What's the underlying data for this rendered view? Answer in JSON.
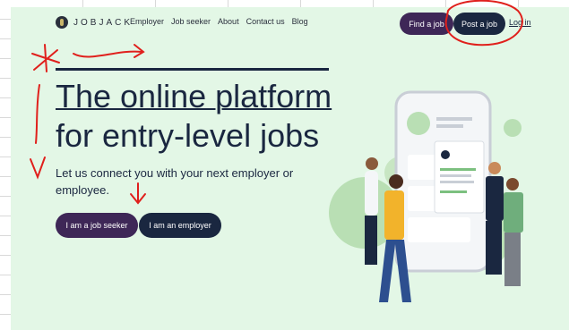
{
  "header": {
    "logo_text": "JOBJACK",
    "nav": [
      "Employer",
      "Job seeker",
      "About",
      "Contact us",
      "Blog"
    ],
    "find_job": "Find a job",
    "post_job": "Post a job",
    "login": "Log in"
  },
  "hero": {
    "title_line1": "The online platform",
    "title_line2": "for entry-level jobs",
    "subtitle": "Let us connect you with your next employer or employee.",
    "cta_seeker": "I am a job seeker",
    "cta_employer": "I am an employer"
  },
  "colors": {
    "background": "#e3f7e6",
    "navy": "#1a2740",
    "purple": "#3e2757",
    "annotation_red": "#e0201c"
  }
}
